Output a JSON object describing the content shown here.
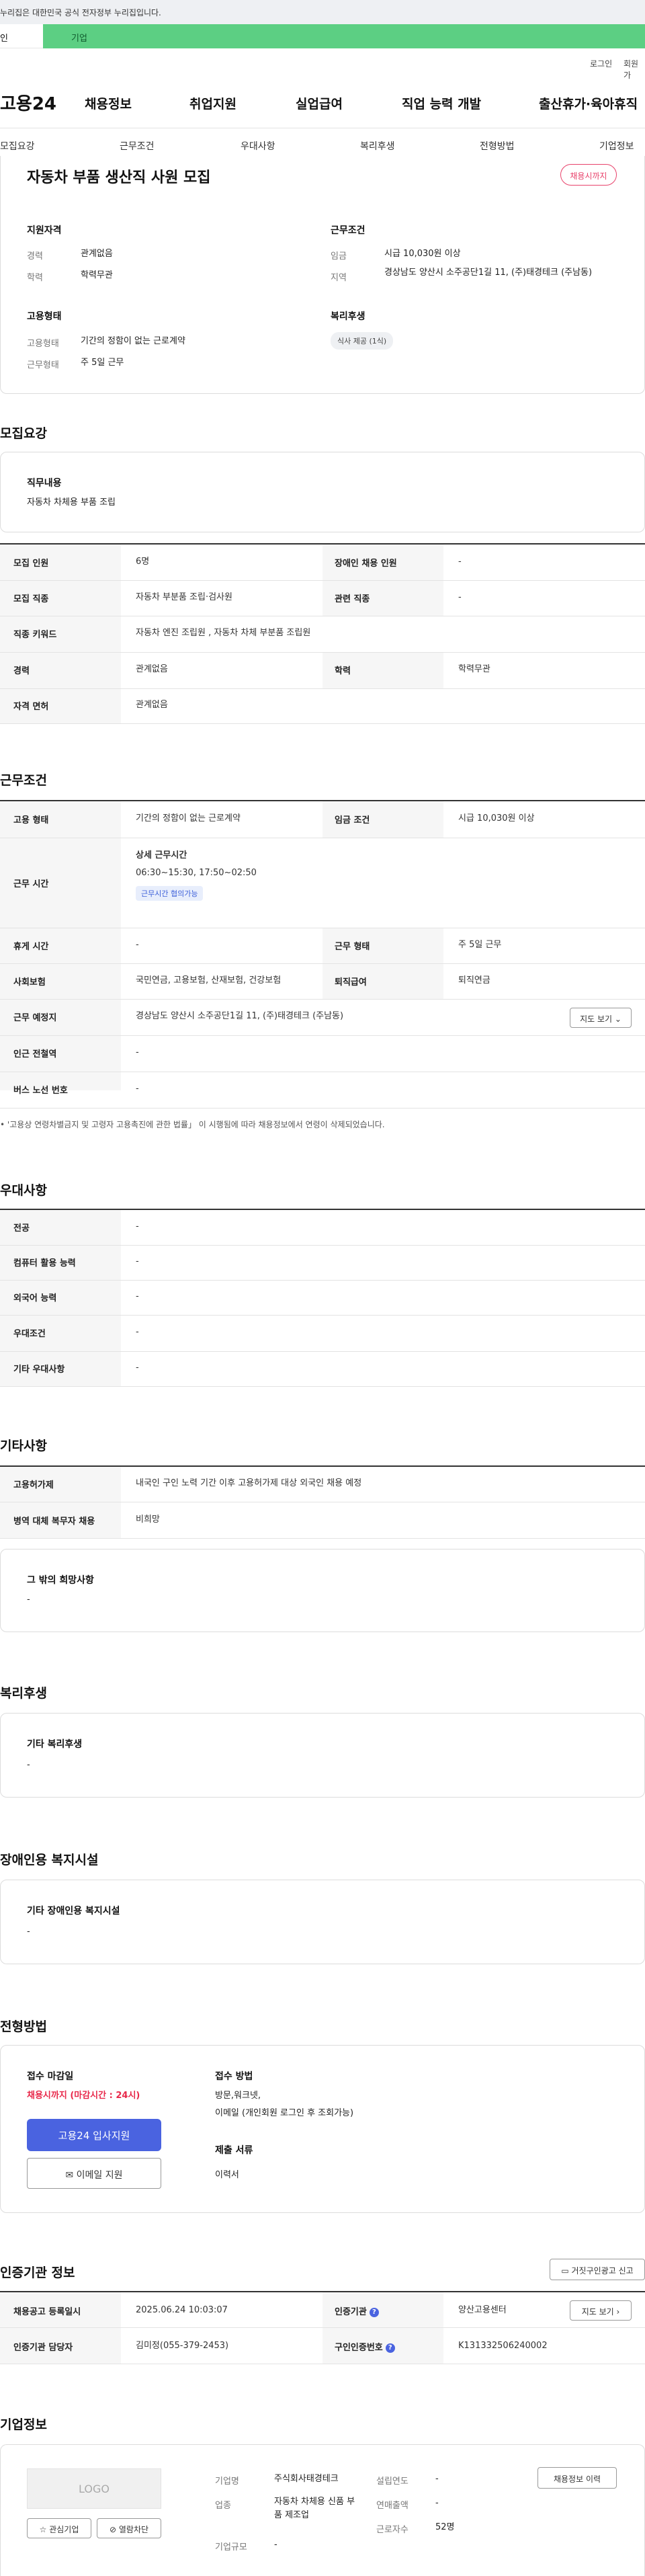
{
  "banner": {
    "text": "누리집은 대한민국 공식 전자정부 누리집입니다."
  },
  "tabs": {
    "personal": "인",
    "company": "기업"
  },
  "util": {
    "login": "로그인",
    "signup": "회원가"
  },
  "header": {
    "logo": "고용24",
    "gnb": [
      "채용정보",
      "취업지원",
      "실업급여",
      "직업 능력 개발",
      "출산휴가·육아휴직"
    ]
  },
  "subnav": [
    "모집요강",
    "근무조건",
    "우대사항",
    "복리후생",
    "전형방법",
    "기업정보"
  ],
  "summary": {
    "title": "자동차 부품 생산직 사원 모집",
    "status_badge": "채용시까지",
    "qual_title": "지원자격",
    "career_label": "경력",
    "career_value": "관계없음",
    "edu_label": "학력",
    "edu_value": "학력무관",
    "cond_title": "근무조건",
    "wage_label": "임금",
    "wage_value": "시급 10,030원 이상",
    "region_label": "지역",
    "region_value": "경상남도 양산시 소주공단1길 11, (주)태경테크 (주남동)",
    "emp_title": "고용형태",
    "emptype_label": "고용형태",
    "emptype_value": "기간의 정함이 없는 근로계약",
    "worktype_label": "근무형태",
    "worktype_value": "주 5일 근무",
    "welfare_title": "복리후생",
    "welfare_chip": "식사 제공 (1식)"
  },
  "recruit": {
    "section_title": "모집요강",
    "duty_title": "직무내용",
    "duty_value": "자동차 차체용 부품 조립",
    "rows": {
      "headcount_label": "모집 인원",
      "headcount_value": "6명",
      "disabled_label": "장애인 채용 인원",
      "disabled_value": "-",
      "job_label": "모집 직종",
      "job_value": "자동차 부분품 조립·검사원",
      "related_label": "관련 직종",
      "related_value": "-",
      "keyword_label": "직종 키워드",
      "keyword_value": "자동차 엔진 조립원 , 자동차 차체 부분품 조립원",
      "career_label": "경력",
      "career_value": "관계없음",
      "edu_label": "학력",
      "edu_value": "학력무관",
      "license_label": "자격 면허",
      "license_value": "관계없음"
    }
  },
  "work": {
    "section_title": "근무조건",
    "emptype_label": "고용 형태",
    "emptype_value": "기간의 정함이 없는 근로계약",
    "wage_label": "임금 조건",
    "wage_value": "시급 10,030원 이상",
    "hours_label": "근무 시간",
    "hours_sub": "상세 근무시간",
    "hours_value": "06:30~15:30, 17:50~02:50",
    "hours_chip": "근무시간 협의가능",
    "break_label": "휴게 시간",
    "break_value": "-",
    "worktype_label": "근무 형태",
    "worktype_value": "주 5일 근무",
    "insurance_label": "사회보험",
    "insurance_value": "국민연금, 고용보험, 산재보험, 건강보험",
    "severance_label": "퇴직급여",
    "severance_value": "퇴직연금",
    "location_label": "근무 예정지",
    "location_value": "경상남도 양산시 소주공단1길 11, (주)태경테크 (주남동)",
    "map_button": "지도 보기",
    "subway_label": "인근 전철역",
    "subway_value": "-",
    "bus_label": "버스 노선 번호",
    "bus_value": "-",
    "note": "• '고용상 연령차별금지 및 고령자 고용촉진에 관한 법률」 이 시행됨에 따라 채용정보에서 연령이 삭제되었습니다."
  },
  "preference": {
    "section_title": "우대사항",
    "major_label": "전공",
    "major_value": "-",
    "computer_label": "컴퓨터 활용 능력",
    "computer_value": "-",
    "language_label": "외국어 능력",
    "language_value": "-",
    "cond_label": "우대조건",
    "cond_value": "-",
    "etc_label": "기타 우대사항",
    "etc_value": "-"
  },
  "etc": {
    "section_title": "기타사항",
    "permit_label": "고용허가제",
    "permit_value": "내국인 구인 노력 기간 이후 고용허가제 대상 외국인 채용 예정",
    "military_label": "병역 대체 복무자 채용",
    "military_value": "비희망",
    "wish_title": "그 밖의 희망사항",
    "wish_value": "-"
  },
  "welfare": {
    "section_title": "복리후생",
    "box_title": "기타 복리후생",
    "box_value": "-"
  },
  "disabled": {
    "section_title": "장애인용 복지시설",
    "box_title": "기타 장애인용 복지시설",
    "box_value": "-"
  },
  "selection": {
    "section_title": "전형방법",
    "deadline_title": "접수 마감일",
    "deadline_value": "채용시까지 (마감시간 : 24시)",
    "apply_button": "고용24 입사지원",
    "email_button": "이메일 지원",
    "method_title": "접수 방법",
    "method_value": "방문,워크넷,",
    "method_value2": "이메일 (개인회원 로그인 후 조회가능)",
    "docs_title": "제출 서류",
    "docs_value": "이력서"
  },
  "agency": {
    "section_title": "인증기관 정보",
    "report_button": "거짓구인광고 신고",
    "regdate_label": "채용공고 등록일시",
    "regdate_value": "2025.06.24 10:03:07",
    "org_label": "인증기관",
    "org_value": "양산고용센터",
    "map_button": "지도 보기",
    "manager_label": "인증기관 담당자",
    "manager_value": "김미정(055-379-2453)",
    "authno_label": "구인인증번호",
    "authno_value": "K131332506240002"
  },
  "company": {
    "section_title": "기업정보",
    "logo_placeholder": "LOGO",
    "favorite_button": "관심기업",
    "block_button": "열람차단",
    "name_label": "기업명",
    "name_value": "주식회사태경테크",
    "industry_label": "업종",
    "industry_value": "자동차 차체용 신품 부품 제조업",
    "size_label": "기업규모",
    "size_value": "-",
    "founded_label": "설립연도",
    "founded_value": "-",
    "revenue_label": "연매출액",
    "revenue_value": "-",
    "employees_label": "근로자수",
    "employees_value": "52명",
    "history_button": "채용정보 이력"
  },
  "colors": {
    "accent_green": "#5ccf83",
    "primary_blue": "#4a63e0",
    "deadline_red": "#e8284a"
  }
}
